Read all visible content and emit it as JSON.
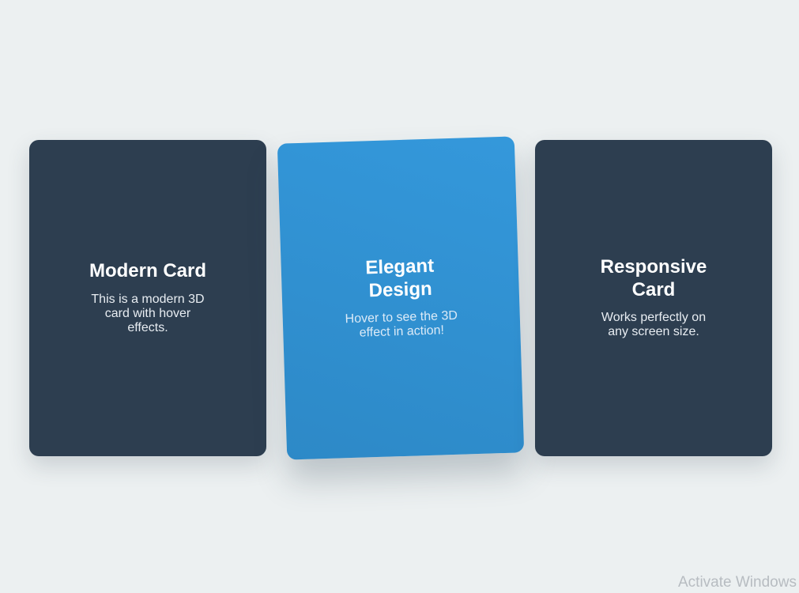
{
  "cards": [
    {
      "title": "Modern Card",
      "text": "This is a modern 3D card with hover effects.",
      "background": "#2d3e50"
    },
    {
      "title": "Elegant Design",
      "text": "Hover to see the 3D effect in action!",
      "background": "#3498db"
    },
    {
      "title": "Responsive Card",
      "text": "Works perfectly on any screen size.",
      "background": "#2d3e50"
    }
  ],
  "page": {
    "background": "#ecf0f1"
  },
  "watermark": {
    "text": "Activate Windows"
  }
}
